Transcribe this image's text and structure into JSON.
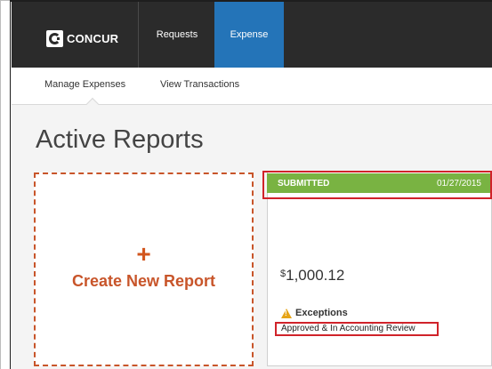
{
  "nav": {
    "logo_text": "CONCUR",
    "items": [
      {
        "label": "Requests"
      },
      {
        "label": "Expense"
      }
    ]
  },
  "subnav": {
    "items": [
      {
        "label": "Manage Expenses"
      },
      {
        "label": "View Transactions"
      }
    ]
  },
  "page": {
    "title": "Active Reports"
  },
  "create_tile": {
    "plus": "+",
    "label": "Create New Report"
  },
  "report": {
    "status": "SUBMITTED",
    "date": "01/27/2015",
    "currency": "$",
    "amount": "1,000.12",
    "exceptions_label": "Exceptions",
    "approval_status": "Approved & In Accounting Review"
  },
  "colors": {
    "nav_bg": "#2b2b2b",
    "expense_active": "#2474b8",
    "status_green": "#79b342",
    "create_orange": "#c8552a",
    "highlight_red": "#d0232a",
    "warning_yellow": "#e6a417"
  }
}
